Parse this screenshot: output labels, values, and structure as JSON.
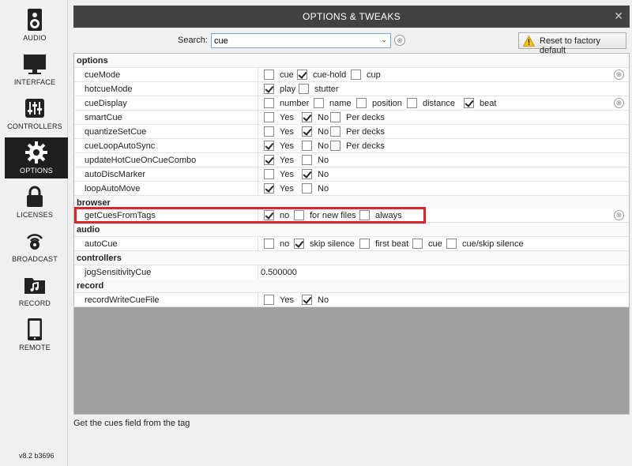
{
  "sidebar": {
    "items": [
      {
        "label": "AUDIO",
        "icon": "speaker-icon"
      },
      {
        "label": "INTERFACE",
        "icon": "monitor-icon"
      },
      {
        "label": "CONTROLLERS",
        "icon": "sliders-icon"
      },
      {
        "label": "OPTIONS",
        "icon": "gear-icon"
      },
      {
        "label": "LICENSES",
        "icon": "lock-icon"
      },
      {
        "label": "BROADCAST",
        "icon": "broadcast-icon"
      },
      {
        "label": "RECORD",
        "icon": "music-folder-icon"
      },
      {
        "label": "REMOTE",
        "icon": "tablet-icon"
      }
    ],
    "active": "OPTIONS",
    "version": "v8.2 b3696"
  },
  "window": {
    "title": "OPTIONS & TWEAKS",
    "close": "✕"
  },
  "search": {
    "label": "Search:",
    "value": "cue",
    "dropdown": "⌄",
    "clear": "⊗"
  },
  "reset_button": "Reset to factory default",
  "sections": [
    {
      "name": "options"
    },
    {
      "name": "browser"
    },
    {
      "name": "audio"
    },
    {
      "name": "controllers"
    },
    {
      "name": "record"
    }
  ],
  "rows": [
    {
      "name": "cueMode",
      "options": [
        {
          "label": "cue",
          "checked": false
        },
        {
          "label": "cue-hold",
          "checked": true
        },
        {
          "label": "cup",
          "checked": false
        }
      ],
      "clear": true
    },
    {
      "name": "hotcueMode",
      "options": [
        {
          "label": "play",
          "checked": true
        },
        {
          "label": "stutter",
          "checked": false
        }
      ]
    },
    {
      "name": "cueDisplay",
      "options": [
        {
          "label": "number",
          "checked": false
        },
        {
          "label": "name",
          "checked": false
        },
        {
          "label": "position",
          "checked": false
        },
        {
          "label": "distance",
          "checked": false
        },
        {
          "label": "beat",
          "checked": true
        }
      ],
      "clear": true
    },
    {
      "name": "smartCue",
      "options": [
        {
          "label": "Yes",
          "checked": false
        },
        {
          "label": "No",
          "checked": true
        },
        {
          "label": "Per decks",
          "checked": false
        }
      ]
    },
    {
      "name": "quantizeSetCue",
      "options": [
        {
          "label": "Yes",
          "checked": false
        },
        {
          "label": "No",
          "checked": true
        },
        {
          "label": "Per decks",
          "checked": false
        }
      ]
    },
    {
      "name": "cueLoopAutoSync",
      "options": [
        {
          "label": "Yes",
          "checked": true
        },
        {
          "label": "No",
          "checked": false
        },
        {
          "label": "Per decks",
          "checked": false
        }
      ]
    },
    {
      "name": "updateHotCueOnCueCombo",
      "options": [
        {
          "label": "Yes",
          "checked": true
        },
        {
          "label": "No",
          "checked": false
        }
      ]
    },
    {
      "name": "autoDiscMarker",
      "options": [
        {
          "label": "Yes",
          "checked": false
        },
        {
          "label": "No",
          "checked": true
        }
      ]
    },
    {
      "name": "loopAutoMove",
      "options": [
        {
          "label": "Yes",
          "checked": true
        },
        {
          "label": "No",
          "checked": false
        }
      ]
    },
    {
      "name": "getCuesFromTags",
      "options": [
        {
          "label": "no",
          "checked": true
        },
        {
          "label": "for new files",
          "checked": false
        },
        {
          "label": "always",
          "checked": false
        }
      ],
      "clear": true
    },
    {
      "name": "autoCue",
      "options": [
        {
          "label": "no",
          "checked": false
        },
        {
          "label": "skip silence",
          "checked": true
        },
        {
          "label": "first beat",
          "checked": false
        },
        {
          "label": "cue",
          "checked": false
        },
        {
          "label": "cue/skip silence",
          "checked": false
        }
      ]
    },
    {
      "name": "jogSensitivityCue",
      "value": "0.500000"
    },
    {
      "name": "recordWriteCueFile",
      "options": [
        {
          "label": "Yes",
          "checked": false
        },
        {
          "label": "No",
          "checked": true
        }
      ]
    }
  ],
  "description": "Get the cues field from the tag",
  "colors": {
    "titlebar": "#424242",
    "active_sidebar": "#1e1e1e",
    "highlight": "#d9252b"
  }
}
